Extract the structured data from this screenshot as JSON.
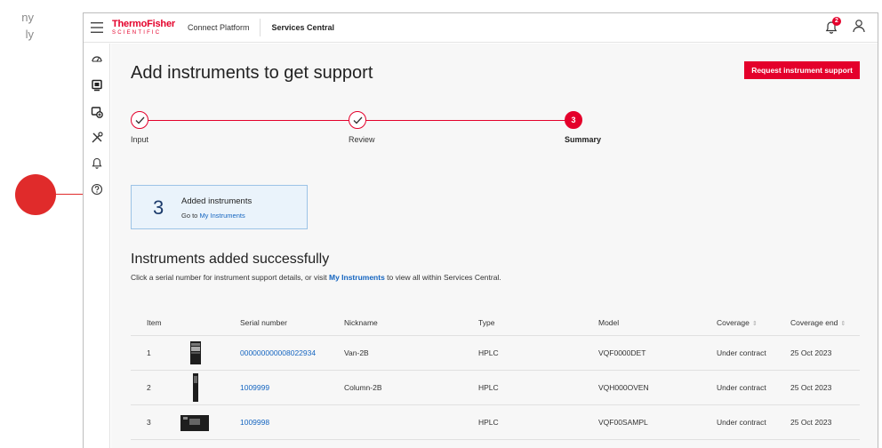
{
  "outside": {
    "line1": "ny",
    "line2": "ly"
  },
  "header": {
    "logo_top": "ThermoFisher",
    "logo_bottom": "SCIENTIFIC",
    "connect_platform": "Connect Platform",
    "services_central": "Services Central",
    "notification_count": "2"
  },
  "page": {
    "title": "Add instruments to get support",
    "request_button": "Request instrument support"
  },
  "stepper": {
    "steps": [
      {
        "label": "Input",
        "state": "done"
      },
      {
        "label": "Review",
        "state": "done"
      },
      {
        "label": "Summary",
        "state": "active",
        "number": "3"
      }
    ]
  },
  "count_card": {
    "count": "3",
    "title": "Added instruments",
    "goto_prefix": "Go to ",
    "goto_link": "My Instruments"
  },
  "section": {
    "title": "Instruments added successfully",
    "desc_before": "Click a serial number for instrument support details, or visit ",
    "desc_link": "My Instruments",
    "desc_after": " to view all within Services Central."
  },
  "table": {
    "headers": {
      "item": "Item",
      "serial": "Serial number",
      "nickname": "Nickname",
      "type": "Type",
      "model": "Model",
      "coverage": "Coverage",
      "coverage_end": "Coverage end"
    },
    "rows": [
      {
        "item": "1",
        "image": "hplc-tower-icon",
        "serial": "000000000008022934",
        "nickname": "Van-2B",
        "type": "HPLC",
        "model": "VQF0000DET",
        "coverage": "Under contract",
        "coverage_end": "25 Oct 2023"
      },
      {
        "item": "2",
        "image": "column-oven-icon",
        "serial": "1009999",
        "nickname": "Column-2B",
        "type": "HPLC",
        "model": "VQH000OVEN",
        "coverage": "Under contract",
        "coverage_end": "25 Oct 2023"
      },
      {
        "item": "3",
        "image": "autosampler-icon",
        "serial": "1009998",
        "nickname": "",
        "type": "HPLC",
        "model": "VQF00SAMPL",
        "coverage": "Under contract",
        "coverage_end": "25 Oct 2023"
      }
    ]
  },
  "colors": {
    "brand_red": "#e4002b",
    "link_blue": "#1565c0",
    "card_bg": "#eaf3fb"
  }
}
